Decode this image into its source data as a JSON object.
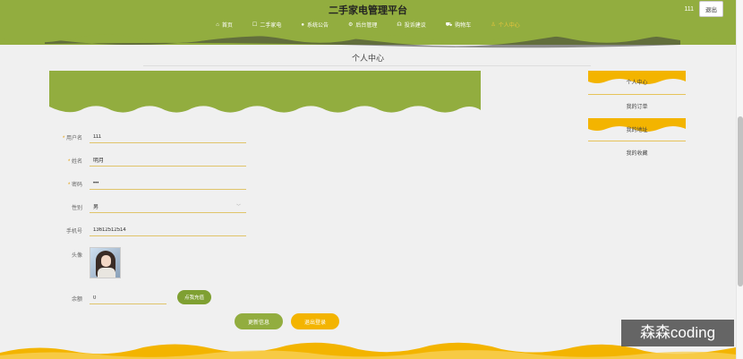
{
  "header": {
    "title": "二手家电管理平台",
    "user": "111",
    "logout_label": "退出"
  },
  "nav": [
    {
      "label": "首页",
      "icon": "home-icon",
      "glyph": "⌂"
    },
    {
      "label": "二手家电",
      "icon": "bag-icon",
      "glyph": "☐"
    },
    {
      "label": "系统公告",
      "icon": "notice-icon",
      "glyph": "●"
    },
    {
      "label": "后台管理",
      "icon": "gear-icon",
      "glyph": "⚙"
    },
    {
      "label": "投诉建议",
      "icon": "headset-icon",
      "glyph": "☊"
    },
    {
      "label": "购物车",
      "icon": "cart-icon",
      "glyph": "⛟"
    },
    {
      "label": "个人中心",
      "icon": "user-icon",
      "glyph": "♙"
    }
  ],
  "page": {
    "heading": "个人中心"
  },
  "form": {
    "username_label": "用户名",
    "username_value": "111",
    "name_label": "姓名",
    "name_value": "明月",
    "password_label": "密码",
    "password_value": "•••",
    "gender_label": "性别",
    "gender_value": "男",
    "phone_label": "手机号",
    "phone_value": "13612512514",
    "avatar_label": "头像",
    "balance_label": "余额",
    "balance_value": "0",
    "recharge_label": "点我充值",
    "update_label": "更新信息",
    "logout_label": "退出登录"
  },
  "sidebar": {
    "items": [
      {
        "label": "个人中心"
      },
      {
        "label": "我的订单"
      },
      {
        "label": "我的地址"
      },
      {
        "label": "我的收藏"
      }
    ]
  },
  "watermark": "森森coding",
  "colors": {
    "primary_green": "#92ad3f",
    "accent_yellow": "#f3b400",
    "page_bg": "#f0f0f0"
  }
}
